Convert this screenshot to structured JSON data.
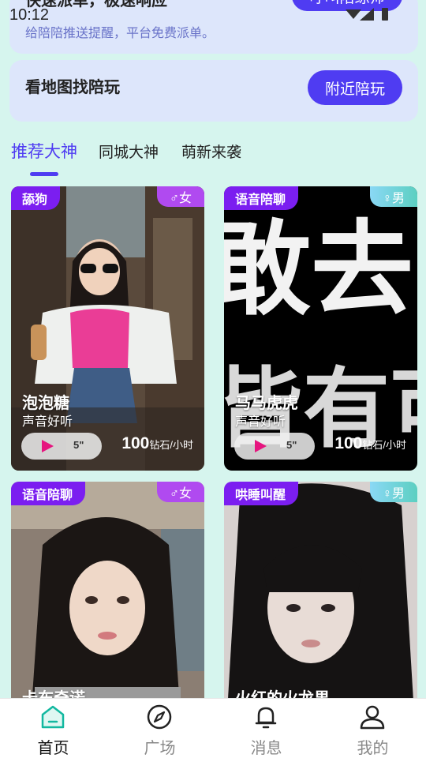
{
  "status": {
    "time": "10:12"
  },
  "banner_call": {
    "title": "快速派单，极速响应",
    "subtitle": "给陪陪推送提醒，平台免费派单。",
    "button": "呼叫陪练师"
  },
  "banner_map": {
    "title": "看地图找陪玩",
    "button": "附近陪玩"
  },
  "tabs": [
    {
      "label": "推荐大神",
      "active": true
    },
    {
      "label": "同城大神",
      "active": false
    },
    {
      "label": "萌新来袭",
      "active": false
    }
  ],
  "cards": [
    {
      "tag": "舔狗",
      "gender": "♂女",
      "name": "泡泡糖",
      "desc": "声音好听",
      "duration": "5\"",
      "price": "100",
      "unit": "钻石/小时"
    },
    {
      "tag": "语音陪聊",
      "gender": "♀男",
      "name": "马马虎虎",
      "desc": "声音好听",
      "duration": "5\"",
      "price": "100",
      "unit": "钻石/小时",
      "photo_text": [
        "敢去",
        "皆有可"
      ]
    },
    {
      "tag": "语音陪聊",
      "gender": "♂女",
      "name": "卡布奇诺"
    },
    {
      "tag": "哄睡叫醒",
      "gender": "♀男",
      "name": "火红的火龙果"
    }
  ],
  "nav": [
    {
      "label": "首页",
      "icon": "home-icon",
      "active": true
    },
    {
      "label": "广场",
      "icon": "compass-icon",
      "active": false
    },
    {
      "label": "消息",
      "icon": "bell-icon",
      "active": false
    },
    {
      "label": "我的",
      "icon": "user-icon",
      "active": false
    }
  ],
  "colors": {
    "accent": "#4f3cf2",
    "tag": "#7b1ef0",
    "nav_active": "#12b8a0",
    "background": "#d6f5ee"
  }
}
